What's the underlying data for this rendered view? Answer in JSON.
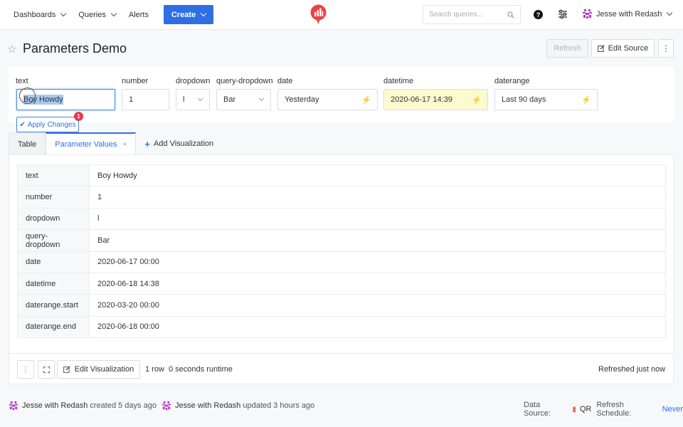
{
  "nav": {
    "items": [
      "Dashboards",
      "Queries",
      "Alerts"
    ],
    "create_label": "Create",
    "search_placeholder": "Search queries...",
    "user_name": "Jesse with Redash"
  },
  "page": {
    "title": "Parameters Demo",
    "refresh_label": "Refresh",
    "edit_source_label": "Edit Source"
  },
  "params": [
    {
      "label": "text",
      "value": "Boy Howdy"
    },
    {
      "label": "number",
      "value": "1"
    },
    {
      "label": "dropdown",
      "value": "l"
    },
    {
      "label": "query-dropdown",
      "value": "Bar"
    },
    {
      "label": "date",
      "value": "Yesterday"
    },
    {
      "label": "datetime",
      "value": "2020-06-17 14:39"
    },
    {
      "label": "daterange",
      "value": "Last 90 days"
    }
  ],
  "apply": {
    "label": "Apply Changes",
    "badge": "1"
  },
  "tabs": {
    "table": "Table",
    "param_values": "Parameter Values",
    "add_viz": "Add Visualization"
  },
  "rows": [
    {
      "key": "text",
      "value": "Boy Howdy"
    },
    {
      "key": "number",
      "value": "1"
    },
    {
      "key": "dropdown",
      "value": "l"
    },
    {
      "key": "query-dropdown",
      "value": "Bar"
    },
    {
      "key": "date",
      "value": "2020-06-17 00:00"
    },
    {
      "key": "datetime",
      "value": "2020-06-18 14:38"
    },
    {
      "key": "daterange.start",
      "value": "2020-03-20 00:00"
    },
    {
      "key": "daterange.end",
      "value": "2020-06-18 00:00"
    }
  ],
  "footer": {
    "edit_viz_label": "Edit Visualization",
    "runtime": "1 row  0 seconds runtime",
    "refreshed": "Refreshed just now"
  },
  "meta": {
    "creator": "Jesse with Redash",
    "created": "created 5 days ago",
    "updater": "Jesse with Redash",
    "updated": "updated 3 hours ago",
    "data_source_label": "Data Source:",
    "data_source": "QR",
    "schedule_label": "Refresh Schedule:",
    "schedule": "Never"
  },
  "colors": {
    "accent": "#2f6fe4",
    "logo": "#ef4044",
    "badge": "#e8394b",
    "changed_bg": "#fdfad0"
  }
}
